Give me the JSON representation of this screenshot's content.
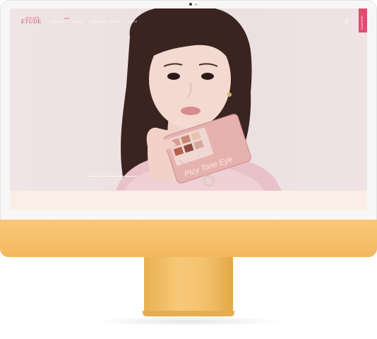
{
  "brand": {
    "logo_small": "pinky pinky",
    "logo": "ETUDE"
  },
  "nav": {
    "items": [
      {
        "label": "EVENTS",
        "badge": "NEW"
      },
      {
        "label": "BRAND"
      },
      {
        "label": "PRODUCTS"
      },
      {
        "label": "STORY"
      },
      {
        "label": "SHOP"
      }
    ]
  },
  "side_tab": {
    "label": "FLAGSHIP"
  },
  "hero": {
    "palette_text": "Play Tone Eye"
  },
  "colors": {
    "accent": "#e24b70",
    "monitor_body": "#f5bd6a",
    "hero_bg": "#ecdfe1"
  }
}
